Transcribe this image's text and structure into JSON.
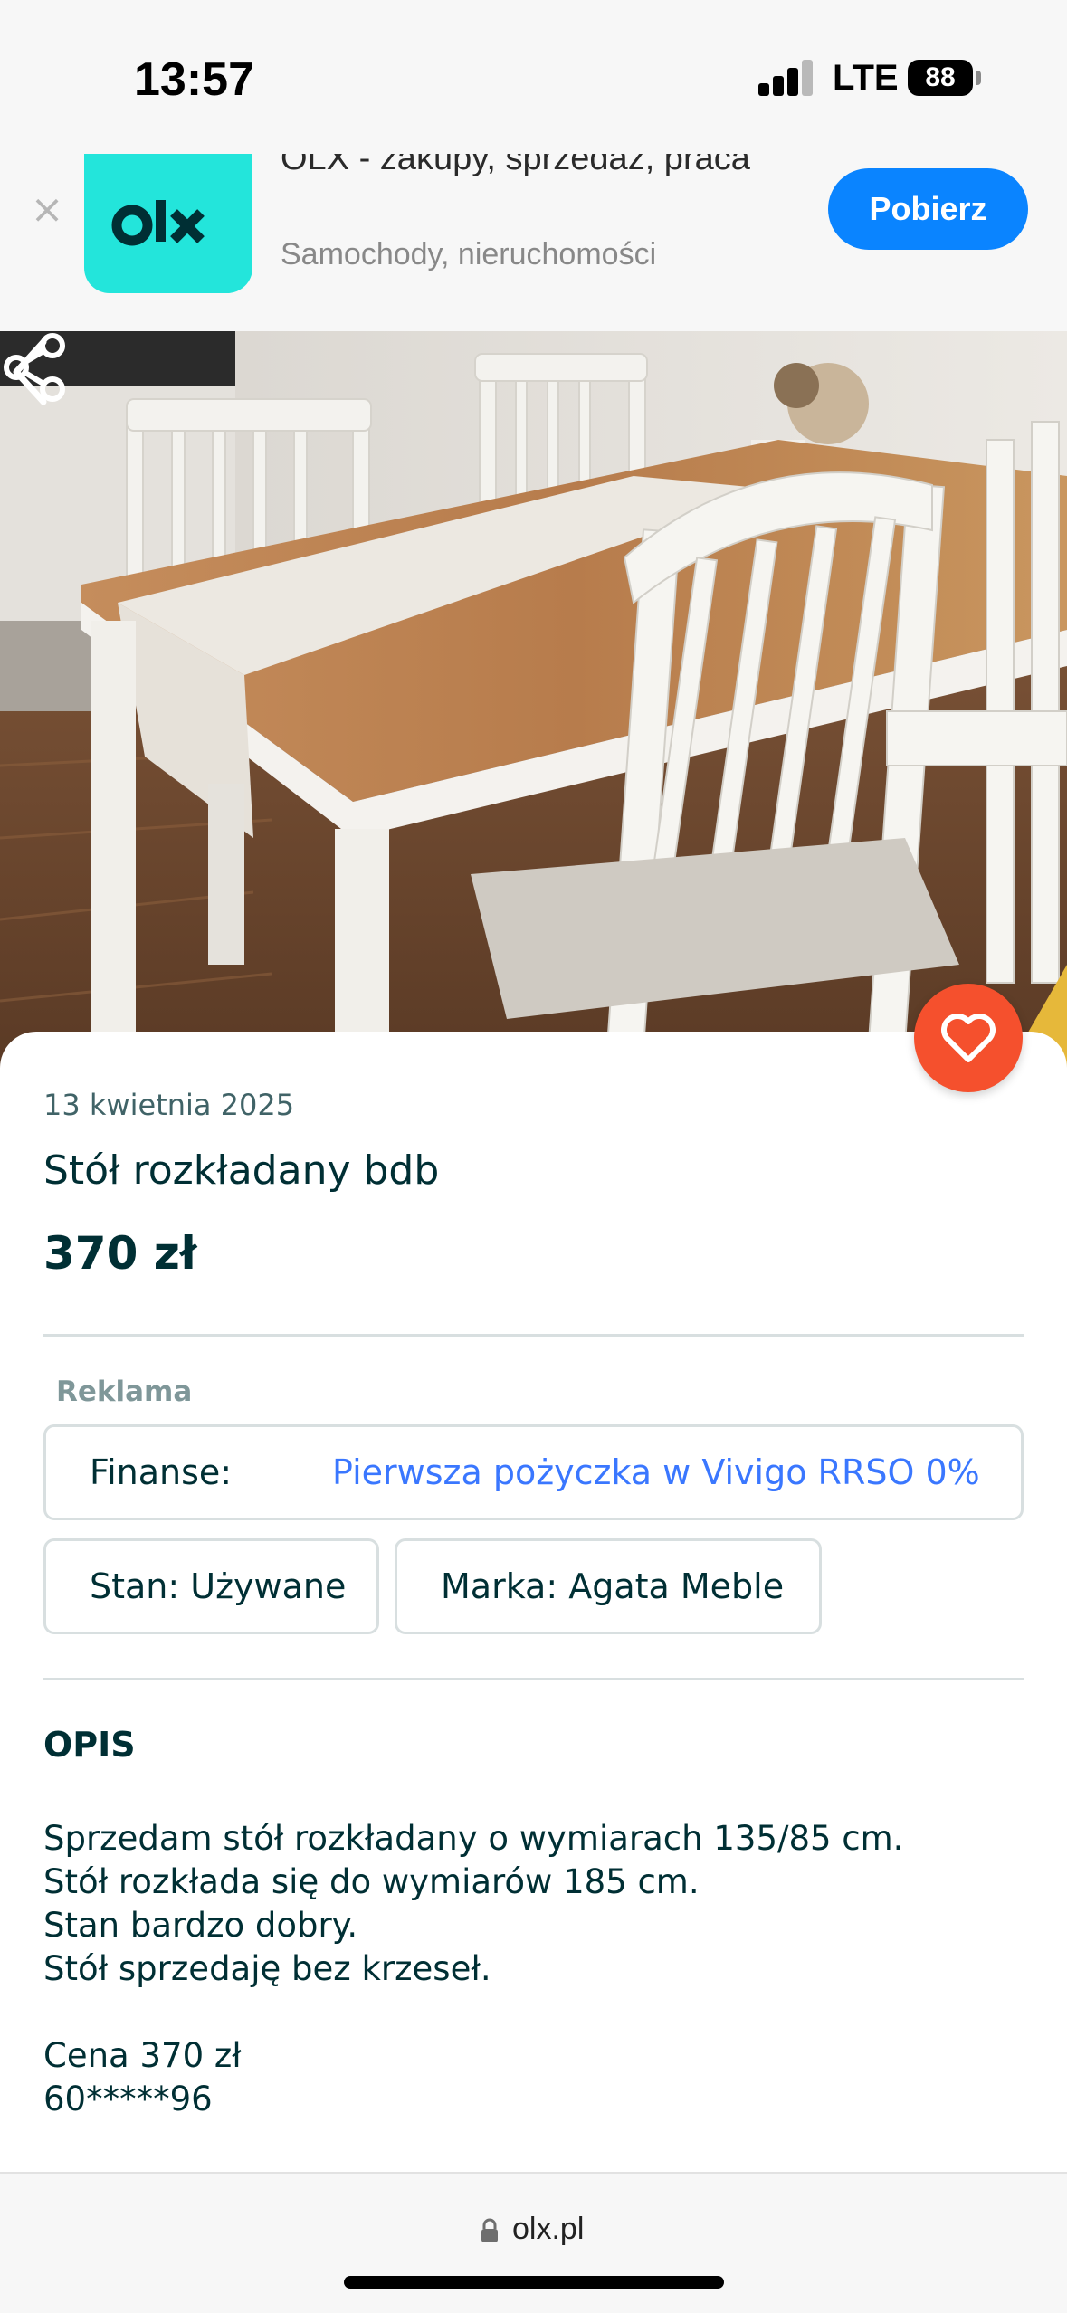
{
  "status_bar": {
    "time": "13:57",
    "network": "LTE",
    "battery": "88"
  },
  "app_banner": {
    "title": "OLX - zakupy, sprzedaż, praca",
    "subtitle": "Samochody, nieruchomości",
    "install_label": "Pobierz",
    "logo_text": "olx",
    "logo_color": "#23e5db",
    "button_color": "#0a84ff"
  },
  "listing": {
    "date": "13 kwietnia 2025",
    "title": "Stół rozkładany bdb",
    "price": "370 zł",
    "ad_label": "Reklama",
    "finance": {
      "label": "Finanse:",
      "link": "Pierwsza pożyczka w Vivigo RRSO 0%"
    },
    "tags": {
      "state": "Stan: Używane",
      "brand": "Marka: Agata Meble"
    },
    "description_heading": "OPIS",
    "description_lines": [
      "Sprzedam stół rozkładany o wymiarach 135/85 cm.",
      "Stół rozkłada się do wymiarów 185 cm.",
      "Stan bardzo dobry.",
      "Stół sprzedaję bez krzeseł.",
      "Cena 370 zł",
      "60*****96"
    ],
    "favorite_color": "#f5502d"
  },
  "browser": {
    "url": "olx.pl"
  }
}
